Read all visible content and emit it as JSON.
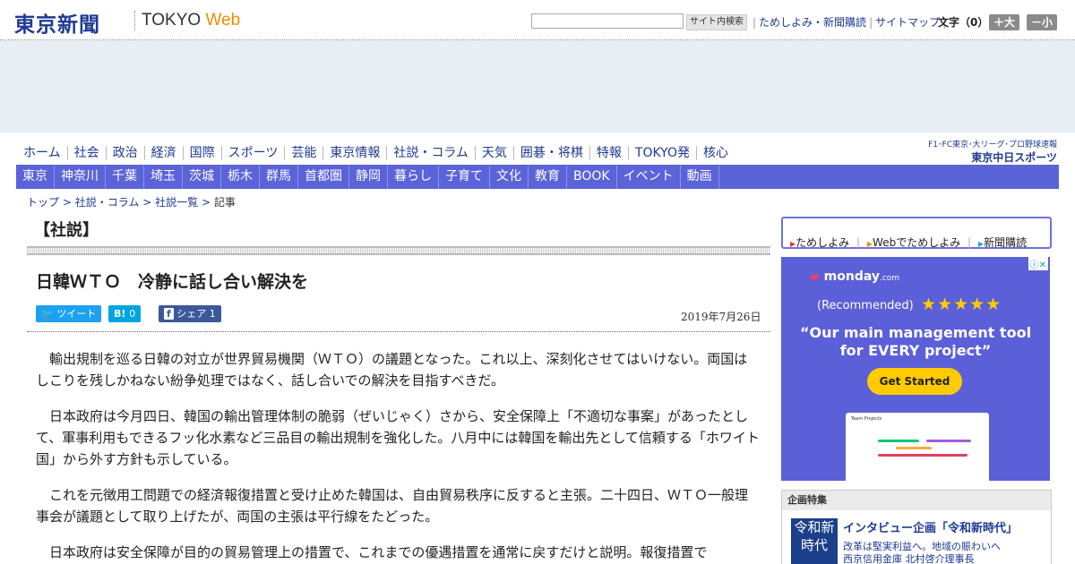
{
  "header": {
    "logo_jp": "東京新聞",
    "logo_tokyo": "TOKYO",
    "logo_web": "Web",
    "search_placeholder": "",
    "search_button": "サイト内検索",
    "util_links": [
      "ためしよみ・新聞購読",
      "サイトマップ"
    ],
    "fontsize_label": "文字（0）",
    "fontsize_up": "＋大",
    "fontsize_down": "－小"
  },
  "nav_primary": [
    "ホーム",
    "社会",
    "政治",
    "経済",
    "国際",
    "スポーツ",
    "芸能",
    "東京情報",
    "社説・コラム",
    "天気",
    "囲碁・将棋",
    "特報",
    "TOKYO発",
    "核心"
  ],
  "chuspo": {
    "line1": "F1･FC東京･大リーグ･プロ野球速報",
    "line2": "東京中日スポーツ"
  },
  "nav_regional": [
    "東京",
    "神奈川",
    "千葉",
    "埼玉",
    "茨城",
    "栃木",
    "群馬",
    "首都圏",
    "静岡",
    "暮らし",
    "子育て",
    "文化",
    "教育",
    "BOOK",
    "イベント",
    "動画"
  ],
  "breadcrumb": {
    "items": [
      "トップ",
      "社説・コラム",
      "社説一覧"
    ],
    "current": "記事",
    "separator": ">"
  },
  "article": {
    "section": "【社説】",
    "title": "日韓ＷＴＯ　冷静に話し合い解決を",
    "date": "2019年7月26日",
    "share": {
      "tweet": "ツイート",
      "hatena_label": "B!",
      "hatena_count": "0",
      "facebook_label": "シェア",
      "facebook_count": "1"
    },
    "paragraphs": [
      "輸出規制を巡る日韓の対立が世界貿易機関（ＷＴＯ）の議題となった。これ以上、深刻化させてはいけない。両国はしこりを残しかねない紛争処理ではなく、話し合いでの解決を目指すべきだ。",
      "日本政府は今月四日、韓国の輸出管理体制の脆弱（ぜいじゃく）さから、安全保障上「不適切な事案」があったとして、軍事利用もできるフッ化水素など三品目の輸出規制を強化した。八月中には韓国を輸出先として信頼する「ホワイト国」から外す方針も示している。",
      "これを元徴用工問題での経済報復措置と受け止めた韓国は、自由貿易秩序に反すると主張。二十四日、ＷＴＯ一般理事会が議題として取り上げたが、両国の主張は平行線をたどった。",
      "日本政府は安全保障が目的の貿易管理上の措置で、これまでの優遇措置を通常に戻すだけと説明。報復措置で"
    ]
  },
  "sidebar": {
    "subscribe_links": [
      "ためしよみ",
      "Webでためしよみ",
      "新聞購読"
    ],
    "ad": {
      "brand": "monday",
      "brand_suffix": ".com",
      "recommended": "(Recommended)",
      "quote": "“Our main management tool for EVERY project”",
      "cta": "Get Started",
      "screenshot_title": "Team Projects"
    },
    "kikaku": {
      "header": "企画特集",
      "badge": "令和新時代",
      "title": "インタビュー企画「令和新時代」",
      "sub1": "改革は堅実利益へ。地域の賑わいへ",
      "sub2": "西京信用金庫 北村啓介理事長"
    }
  },
  "colors": {
    "brand_navy": "#1f3a93",
    "nav_purple": "#5b63d9",
    "web_orange": "#f08c00",
    "twitter": "#1da1f2",
    "hatena": "#00a4de",
    "facebook": "#3b5998",
    "ad_bg": "#5b5fd8",
    "cta_yellow": "#ffcb00"
  }
}
